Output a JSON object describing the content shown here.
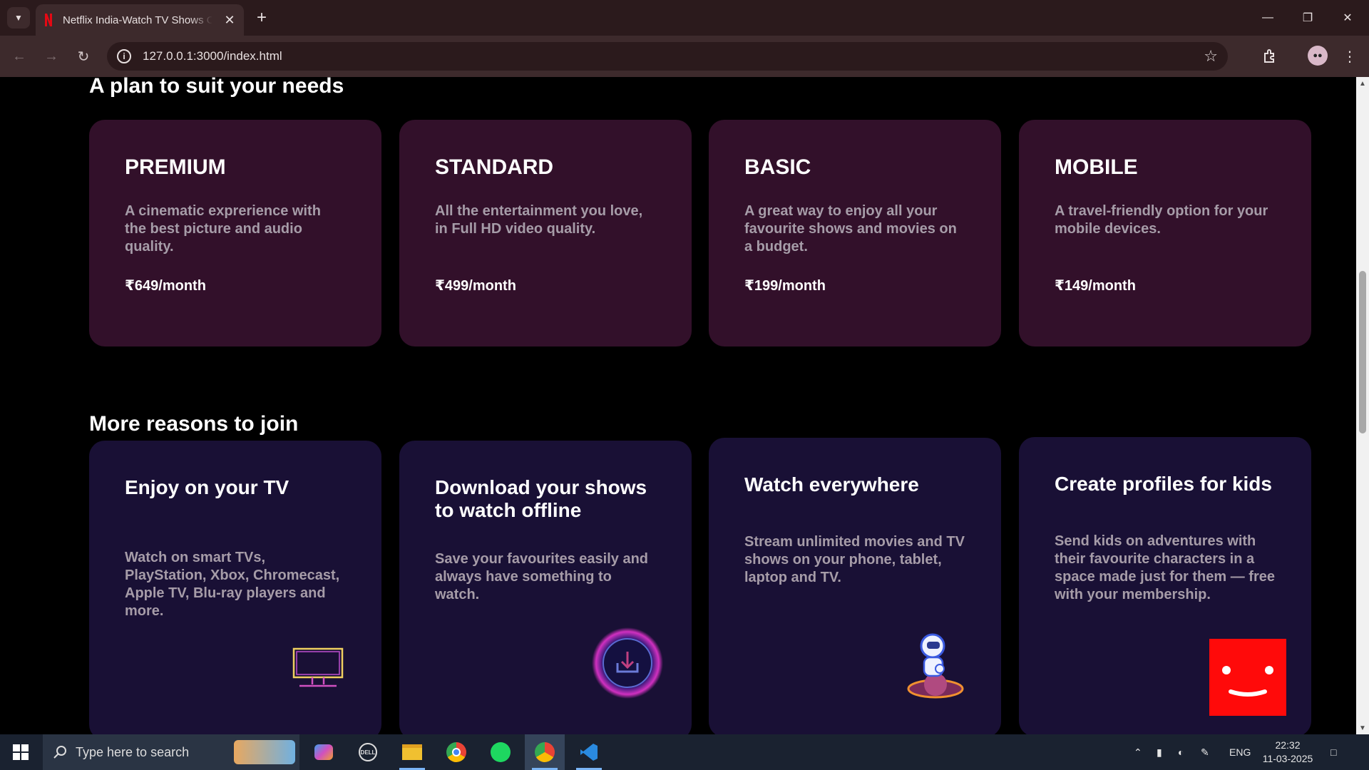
{
  "browser": {
    "tab_title": "Netflix India-Watch TV Shows Online",
    "url": "127.0.0.1:3000/index.html"
  },
  "plans_section": {
    "title": "A plan to suit your needs",
    "plans": [
      {
        "name": "PREMIUM",
        "description": "A cinematic exprerience with the best picture and audio quality.",
        "price": "₹649/month"
      },
      {
        "name": "STANDARD",
        "description": "All the entertainment you love, in Full HD video quality.",
        "price": "₹499/month"
      },
      {
        "name": "BASIC",
        "description": "A great way to enjoy all your favourite shows and movies on a budget.",
        "price": "₹199/month"
      },
      {
        "name": "MOBILE",
        "description": "A travel-friendly option for your mobile devices.",
        "price": "₹149/month"
      }
    ]
  },
  "reasons_section": {
    "title": "More reasons to join",
    "reasons": [
      {
        "title": "Enjoy on your TV",
        "description": "Watch on smart TVs, PlayStation, Xbox, Chromecast, Apple TV, Blu-ray players and more.",
        "icon": "tv-icon"
      },
      {
        "title": "Download your shows to watch offline",
        "description": "Save your favourites easily and always have something to watch.",
        "icon": "download-icon"
      },
      {
        "title": "Watch everywhere",
        "description": "Stream unlimited movies and TV shows on your phone, tablet, laptop and TV.",
        "icon": "astronaut-icon"
      },
      {
        "title": "Create profiles for kids",
        "description": "Send kids on adventures with their favourite characters in a space made just for them — free with your membership.",
        "icon": "smiley-profile-icon"
      }
    ]
  },
  "taskbar": {
    "search_placeholder": "Type here to search",
    "language": "ENG",
    "time": "22:32",
    "date": "11-03-2025"
  },
  "colors": {
    "plan_card_bg": "#32102a",
    "reason_card_bg": "#191035",
    "netflix_red": "#e50914"
  }
}
